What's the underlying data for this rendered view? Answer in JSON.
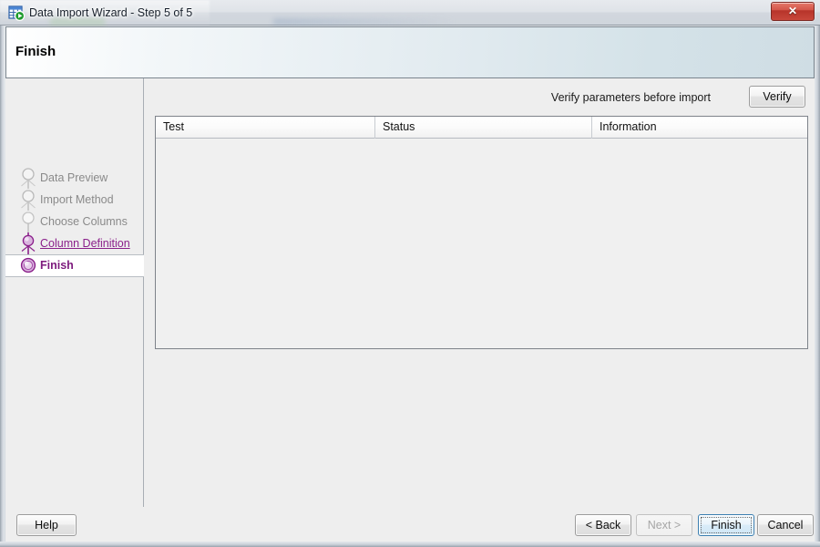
{
  "window": {
    "title": "Data Import Wizard - Step 5 of 5",
    "app_icon": "table-import-icon",
    "close_label": "✕",
    "close_icon": "close-icon"
  },
  "header": {
    "title": "Finish"
  },
  "sidebar": {
    "steps": [
      {
        "label": "Data Preview",
        "state": "done",
        "node_icon": "step-node-inactive-icon"
      },
      {
        "label": "Import Method",
        "state": "done",
        "node_icon": "step-node-inactive-icon"
      },
      {
        "label": "Choose Columns",
        "state": "done",
        "node_icon": "step-node-inactive-icon"
      },
      {
        "label": "Column Definition",
        "state": "link",
        "node_icon": "step-node-visited-icon"
      },
      {
        "label": "Finish",
        "state": "current",
        "node_icon": "step-node-current-icon"
      }
    ]
  },
  "main": {
    "verify_label": "Verify parameters before import",
    "verify_button": "Verify",
    "table": {
      "columns": [
        "Test",
        "Status",
        "Information"
      ],
      "rows": []
    }
  },
  "footer": {
    "help": "Help",
    "back": "< Back",
    "next": "Next >",
    "finish": "Finish",
    "cancel": "Cancel"
  },
  "colors": {
    "accent_purple": "#8a1f8a",
    "current_purple": "#7d1a7d",
    "inactive_gray": "#8a8a8a",
    "header_gradient_start": "#ffffff",
    "header_gradient_end": "#cfdde4",
    "close_red": "#b7342a",
    "default_button_blue": "#3c7fb1"
  }
}
